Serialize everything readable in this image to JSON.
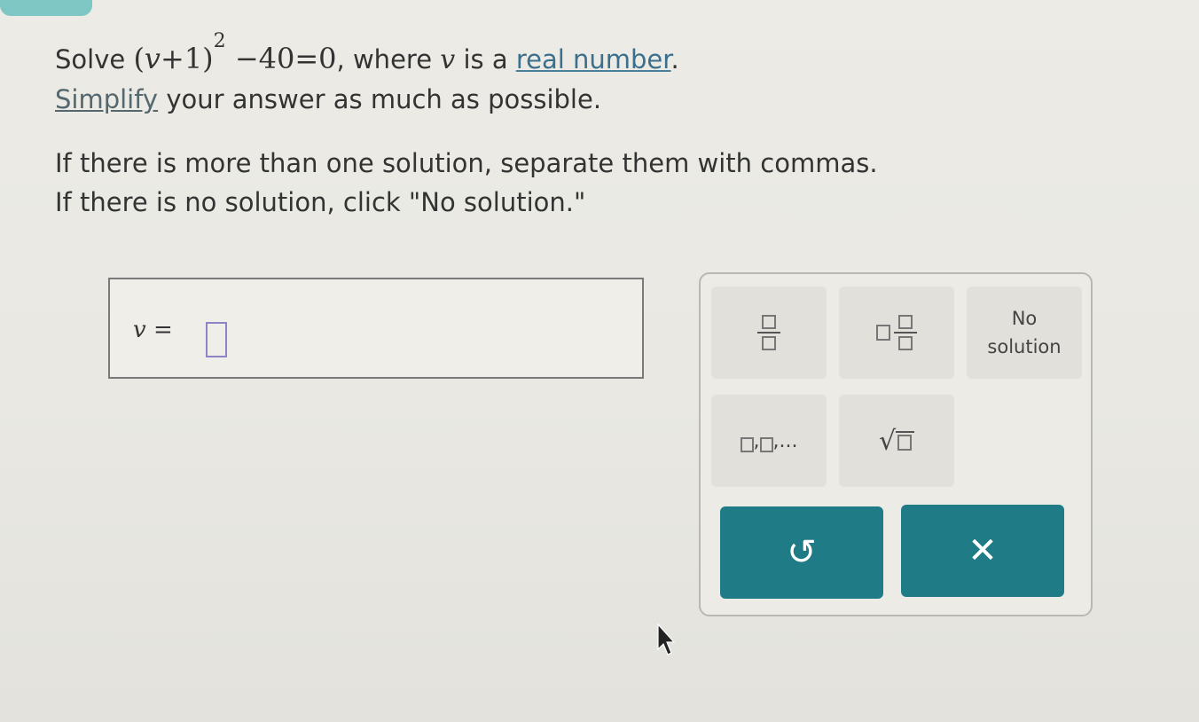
{
  "question": {
    "prefix": "Solve",
    "equation_open": "(",
    "equation_var": "v",
    "equation_plus": "+1)",
    "equation_exp": "2",
    "equation_rest": "−40=0",
    "comma_where": ", where",
    "var_mid": "v",
    "is_a": "is a",
    "real_number_link": "real number",
    "period": ".",
    "simplify_link": "Simplify",
    "simplify_rest": "your answer as much as possible.",
    "multi_solution_text": "If there is more than one solution, separate them with commas.",
    "no_solution_text": "If there is no solution, click \"No solution.\""
  },
  "answer": {
    "var": "v",
    "equals": "=",
    "value": ""
  },
  "keypad": {
    "no_solution_line1": "No",
    "no_solution_line2": "solution",
    "list_key_comma": ",",
    "list_key_ellipsis": ",...",
    "sqrt_symbol": "√",
    "undo_symbol": "↺",
    "clear_symbol": "✕"
  },
  "colors": {
    "accent_teal": "#1f7b86",
    "input_border": "#8d84c7",
    "link_color": "#3b6f8e"
  }
}
